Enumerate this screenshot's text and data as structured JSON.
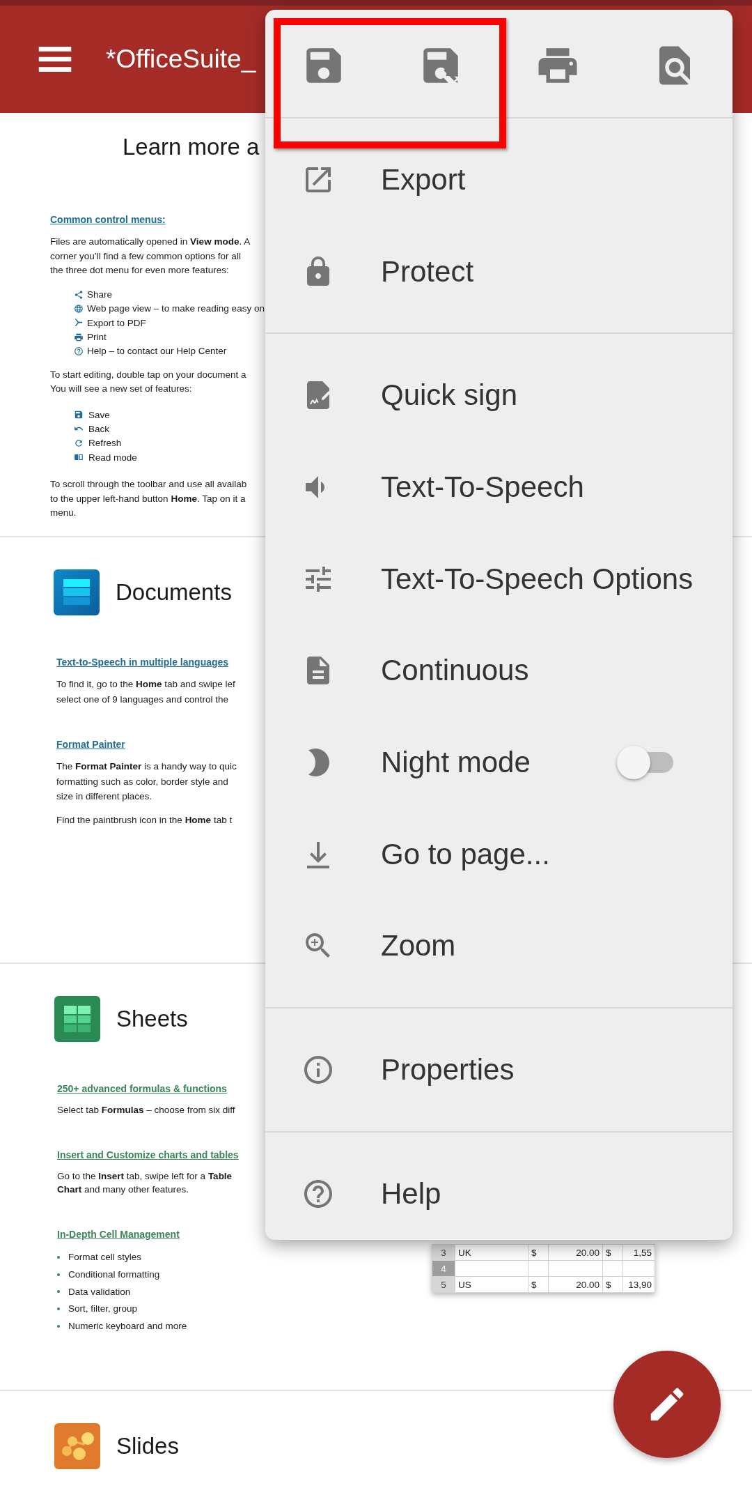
{
  "app_bar": {
    "title": "*OfficeSuite_"
  },
  "document": {
    "heading": "Learn more a",
    "intro": {
      "link": "Common control menus:",
      "paragraph_1": [
        "Files are automatically opened in **View mode**. A",
        "corner you’ll find a few common options for all",
        "the three dot menu for even more features:"
      ],
      "list_1": [
        "Share",
        "Web page view – to make reading easy on",
        "Export to PDF",
        "Print",
        "Help – to contact our Help Center"
      ],
      "paragraph_2": [
        "To start editing, double tap on your document a",
        "You will see a new set of features:"
      ],
      "list_2": [
        "Save",
        "Back",
        "Refresh",
        "Read mode"
      ],
      "paragraph_3": [
        "To scroll through the toolbar and use all availab",
        "to the upper left-hand button **Home**. Tap on it a",
        "menu."
      ]
    },
    "sections": [
      {
        "kind": "documents",
        "title": "Documents",
        "blocks": [
          {
            "link": "Text-to-Speech in multiple languages",
            "paragraphs": [
              [
                "To find it, go to the **Home** tab and swipe lef",
                "select one of 9 languages and control the"
              ]
            ]
          },
          {
            "link": "Format Painter",
            "paragraphs": [
              [
                "The **Format Painter** is a handy way to quic",
                "formatting such as color, border style and",
                "size in different places."
              ],
              [
                "Find the paintbrush icon in the **Home** tab t"
              ]
            ]
          }
        ]
      },
      {
        "kind": "sheets",
        "title": "Sheets",
        "blocks": [
          {
            "link": "250+ advanced formulas & functions",
            "paragraphs": [
              [
                "Select tab **Formulas** – choose from six diff"
              ]
            ]
          },
          {
            "link": "Insert and Customize charts and tables",
            "paragraphs": [
              [
                "Go to the **Insert** tab, swipe left for a **Table**",
                "**Chart** and many other features."
              ]
            ]
          },
          {
            "link": "In-Depth Cell Management",
            "bullets": [
              "Format cell styles",
              "Conditional formatting",
              "Data validation",
              "Sort, filter, group",
              "Numeric keyboard and more"
            ]
          }
        ],
        "table": {
          "rows": [
            {
              "header": "3",
              "selected": false,
              "cells": [
                "UK",
                "$",
                "20.00",
                "$",
                "1,55"
              ]
            },
            {
              "header": "4",
              "selected": true
            },
            {
              "header": "5",
              "selected": false,
              "cells": [
                "US",
                "$",
                "20.00",
                "$",
                "13,90"
              ]
            }
          ]
        }
      },
      {
        "kind": "slides",
        "title": "Slides"
      }
    ]
  },
  "menu": {
    "groups": [
      [
        {
          "kind": "action",
          "label": "Export"
        },
        {
          "kind": "action",
          "label": "Protect"
        }
      ],
      [
        {
          "kind": "action",
          "label": "Quick sign"
        },
        {
          "kind": "action",
          "label": "Text-To-Speech"
        },
        {
          "kind": "action",
          "label": "Text-To-Speech Options"
        },
        {
          "kind": "action",
          "label": "Continuous"
        },
        {
          "kind": "toggle",
          "label": "Night mode",
          "on": false
        },
        {
          "kind": "action",
          "label": "Go to page..."
        },
        {
          "kind": "action",
          "label": "Zoom"
        }
      ],
      [
        {
          "kind": "action",
          "label": "Properties"
        }
      ],
      [
        {
          "kind": "action",
          "label": "Help"
        }
      ]
    ]
  },
  "annotation": {
    "kind": "highlight-rectangle"
  }
}
